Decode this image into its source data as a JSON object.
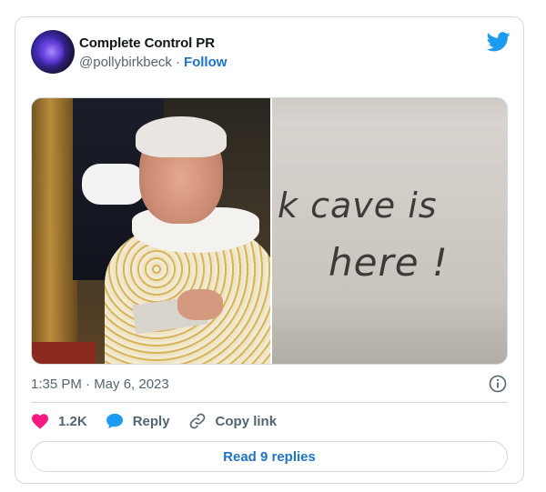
{
  "tweet": {
    "author_name": "Complete Control PR",
    "handle": "@pollybirkbeck",
    "separator": "·",
    "follow_label": "Follow",
    "image_right_text_line1": "k cave is",
    "image_right_text_line2": "here !",
    "timestamp": "1:35 PM · May 6, 2023",
    "likes_count": "1.2K",
    "reply_label": "Reply",
    "copy_link_label": "Copy link",
    "read_replies_label": "Read 9 replies"
  },
  "icons": {
    "brand": "twitter-bird-icon",
    "info": "info-icon",
    "like": "heart-icon",
    "reply": "speech-bubble-icon",
    "copy": "link-icon"
  },
  "colors": {
    "accent": "#1d74c6",
    "twitter_blue": "#1d9bf0",
    "like_red": "#f91880",
    "muted": "#536471",
    "border": "#cfd9de"
  }
}
